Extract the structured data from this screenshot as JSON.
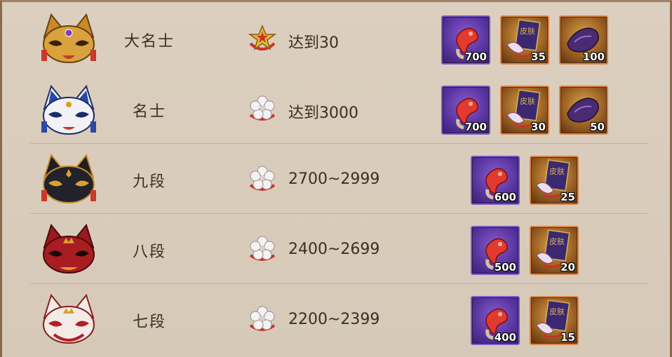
{
  "ranks": [
    {
      "name": "大名士",
      "condition_icon": "gold-star-badge-icon",
      "condition": "达到30",
      "mask_color": "gold",
      "rewards": [
        {
          "type": "red-magatama-icon",
          "count": "700"
        },
        {
          "type": "skin-scroll-icon",
          "count": "35"
        },
        {
          "type": "dark-jade-icon",
          "count": "100"
        }
      ]
    },
    {
      "name": "名士",
      "condition_icon": "white-flower-icon",
      "condition": "达到3000",
      "mask_color": "blue",
      "rewards": [
        {
          "type": "red-magatama-icon",
          "count": "700"
        },
        {
          "type": "skin-scroll-icon",
          "count": "30"
        },
        {
          "type": "dark-jade-icon",
          "count": "50"
        }
      ]
    },
    {
      "name": "九段",
      "condition_icon": "white-flower-icon",
      "condition": "2700~2999",
      "mask_color": "black",
      "rewards": [
        {
          "type": "red-magatama-icon",
          "count": "600"
        },
        {
          "type": "skin-scroll-icon",
          "count": "25"
        }
      ]
    },
    {
      "name": "八段",
      "condition_icon": "white-flower-icon",
      "condition": "2400~2699",
      "mask_color": "red",
      "rewards": [
        {
          "type": "red-magatama-icon",
          "count": "500"
        },
        {
          "type": "skin-scroll-icon",
          "count": "20"
        }
      ]
    },
    {
      "name": "七段",
      "condition_icon": "white-flower-icon",
      "condition": "2200~2399",
      "mask_color": "white-red",
      "rewards": [
        {
          "type": "red-magatama-icon",
          "count": "400"
        },
        {
          "type": "skin-scroll-icon",
          "count": "15"
        }
      ]
    }
  ],
  "skin_scroll_text": "皮肤"
}
